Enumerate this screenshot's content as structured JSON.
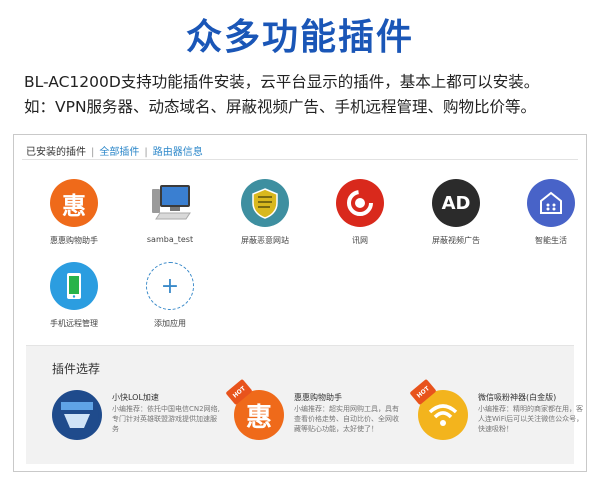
{
  "headline": "众多功能插件",
  "sublines": [
    "BL-AC1200D支持功能插件安装，云平台显示的插件，基本上都可以安装。",
    "如：VPN服务器、动态域名、屏蔽视频广告、手机远程管理、购物比价等。"
  ],
  "tabs": [
    "已安装的插件",
    "全部插件",
    "路由器信息"
  ],
  "tab_separator": "|",
  "installed": [
    {
      "label": "惠惠购物助手",
      "icon": "hui-shopping-icon",
      "glyph": "惠",
      "color": "#ef6a1a"
    },
    {
      "label": "samba_test",
      "icon": "computer-icon",
      "color": "#3a7fd1"
    },
    {
      "label": "屏蔽恶意网站",
      "icon": "shield-icon",
      "color": "#3e8fa0"
    },
    {
      "label": "讯网",
      "icon": "xunwang-icon",
      "color": "#d9291c"
    },
    {
      "label": "屏蔽视频广告",
      "icon": "ad-block-icon",
      "glyph": "AD",
      "color": "#2b2b2b"
    },
    {
      "label": "智能生活",
      "icon": "smart-home-icon",
      "color": "#4863c8"
    },
    {
      "label": "手机远程管理",
      "icon": "phone-remote-icon",
      "color": "#2b9de0"
    },
    {
      "label": "添加应用",
      "icon": "add-icon",
      "glyph": "+",
      "color": "#3a8ac9"
    }
  ],
  "store": {
    "title": "插件选荐",
    "items": [
      {
        "title": "小快LOL加速",
        "desc": "小编推荐：依托中国电信CN2网络,专门针对英雄联盟游戏提供加速服务",
        "icon": "lol-accelerate-icon",
        "hot": false
      },
      {
        "title": "惠惠购物助手",
        "desc": "小编推荐：超实用网购工具，具有查看价格走势、自动比价、全网收藏等贴心功能，太好使了！",
        "icon": "hui-shopping-icon",
        "glyph": "惠",
        "hot": true
      },
      {
        "title": "微信吸粉神器(白金版)",
        "desc": "小编推荐：精明的商家都在用，客人连WiFi后可以关注微信公众号，快速吸粉！",
        "icon": "wechat-wifi-icon",
        "hot": true
      }
    ],
    "hot_label": "HOT"
  },
  "colors": {
    "headline": "#1a56b7",
    "link": "#2a86c9",
    "store_bg": "#f2f2f2",
    "hot": "#e8531c"
  }
}
